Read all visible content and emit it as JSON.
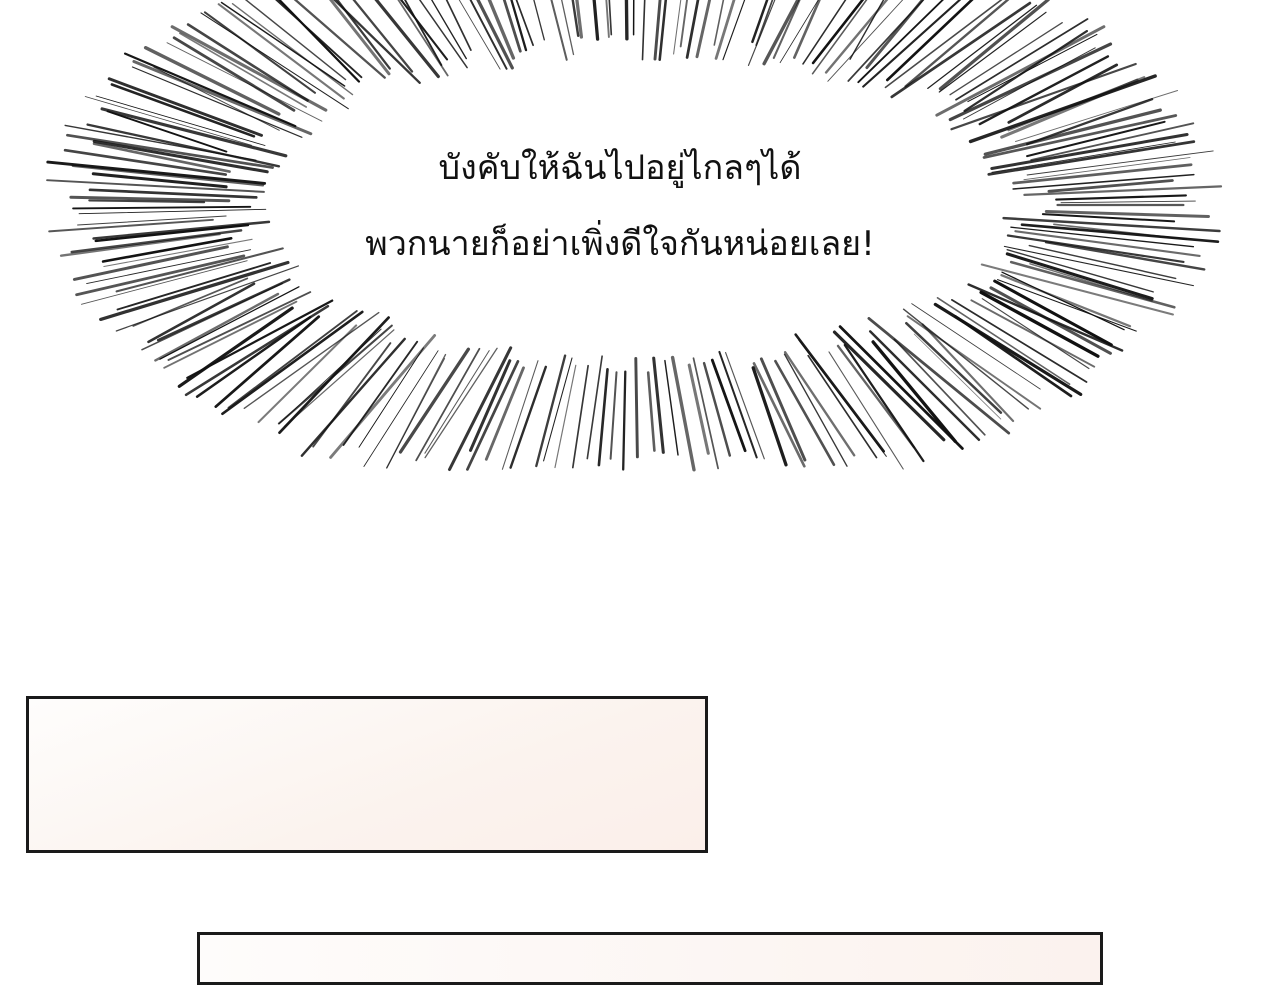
{
  "speech_bubble": {
    "line1": "บังคับให้ฉันไปอยู่ไกลๆได้",
    "line2": "พวกนายก็อย่าเพิ่งดีใจกันหน่อยเลย!",
    "style": "emphasis-burst"
  },
  "colors": {
    "background": "#ffffff",
    "ink": "#111111",
    "panel_fill": "#fbf2ee",
    "panel_border": "#1a1a1a"
  }
}
